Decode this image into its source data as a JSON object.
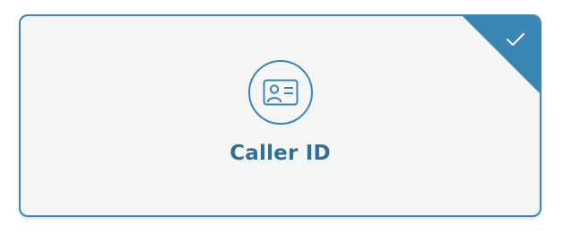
{
  "card": {
    "label": "Caller ID",
    "icon": "id-card-icon",
    "selected": true,
    "selected_indicator_icon": "checkmark-icon"
  },
  "colors": {
    "accent": "#3a86b5",
    "label_text": "#2f6f99",
    "card_background": "#f5f5f5",
    "check_mark": "#ffffff"
  }
}
